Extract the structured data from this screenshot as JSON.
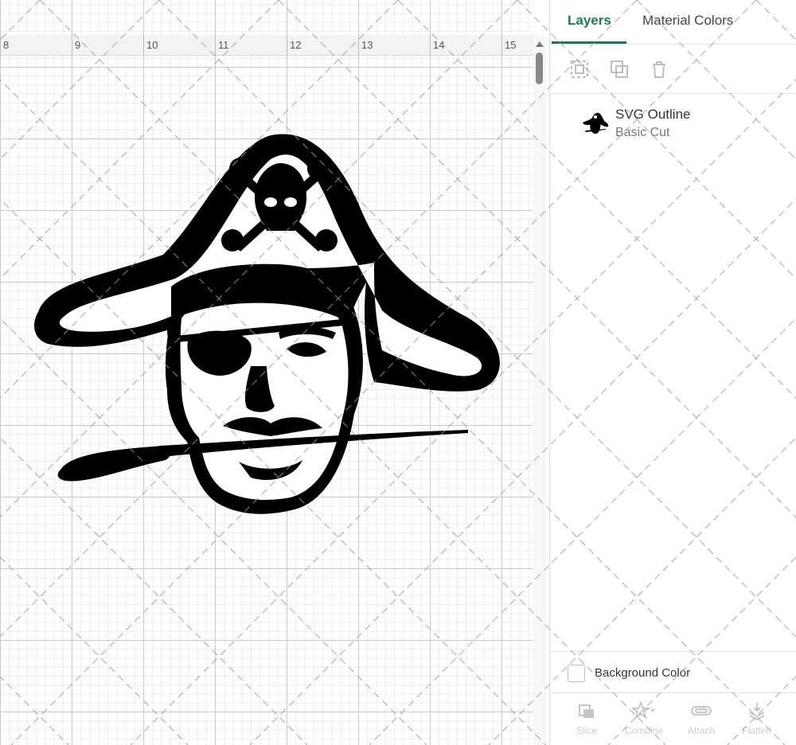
{
  "ruler": {
    "labels": [
      "8",
      "9",
      "10",
      "11",
      "12",
      "13",
      "14",
      "15"
    ]
  },
  "panel": {
    "tabs": [
      {
        "label": "Layers",
        "active": true
      },
      {
        "label": "Material Colors",
        "active": false
      }
    ],
    "toolbar": {
      "group_icon": "group-icon",
      "duplicate_icon": "duplicate-icon",
      "delete_icon": "trash-icon"
    },
    "layers": [
      {
        "name": "SVG Outline",
        "operation": "Basic Cut",
        "thumbnail": "pirate-thumbnail"
      }
    ],
    "background_color_label": "Background Color",
    "bottom_actions": [
      {
        "label": "Slice",
        "icon": "slice-icon"
      },
      {
        "label": "Combine",
        "icon": "combine-icon"
      },
      {
        "label": "Attach",
        "icon": "attach-icon"
      },
      {
        "label": "Flatten",
        "icon": "flatten-icon"
      }
    ]
  },
  "colors": {
    "accent": "#1f7a4f",
    "artwork": "#000000"
  }
}
